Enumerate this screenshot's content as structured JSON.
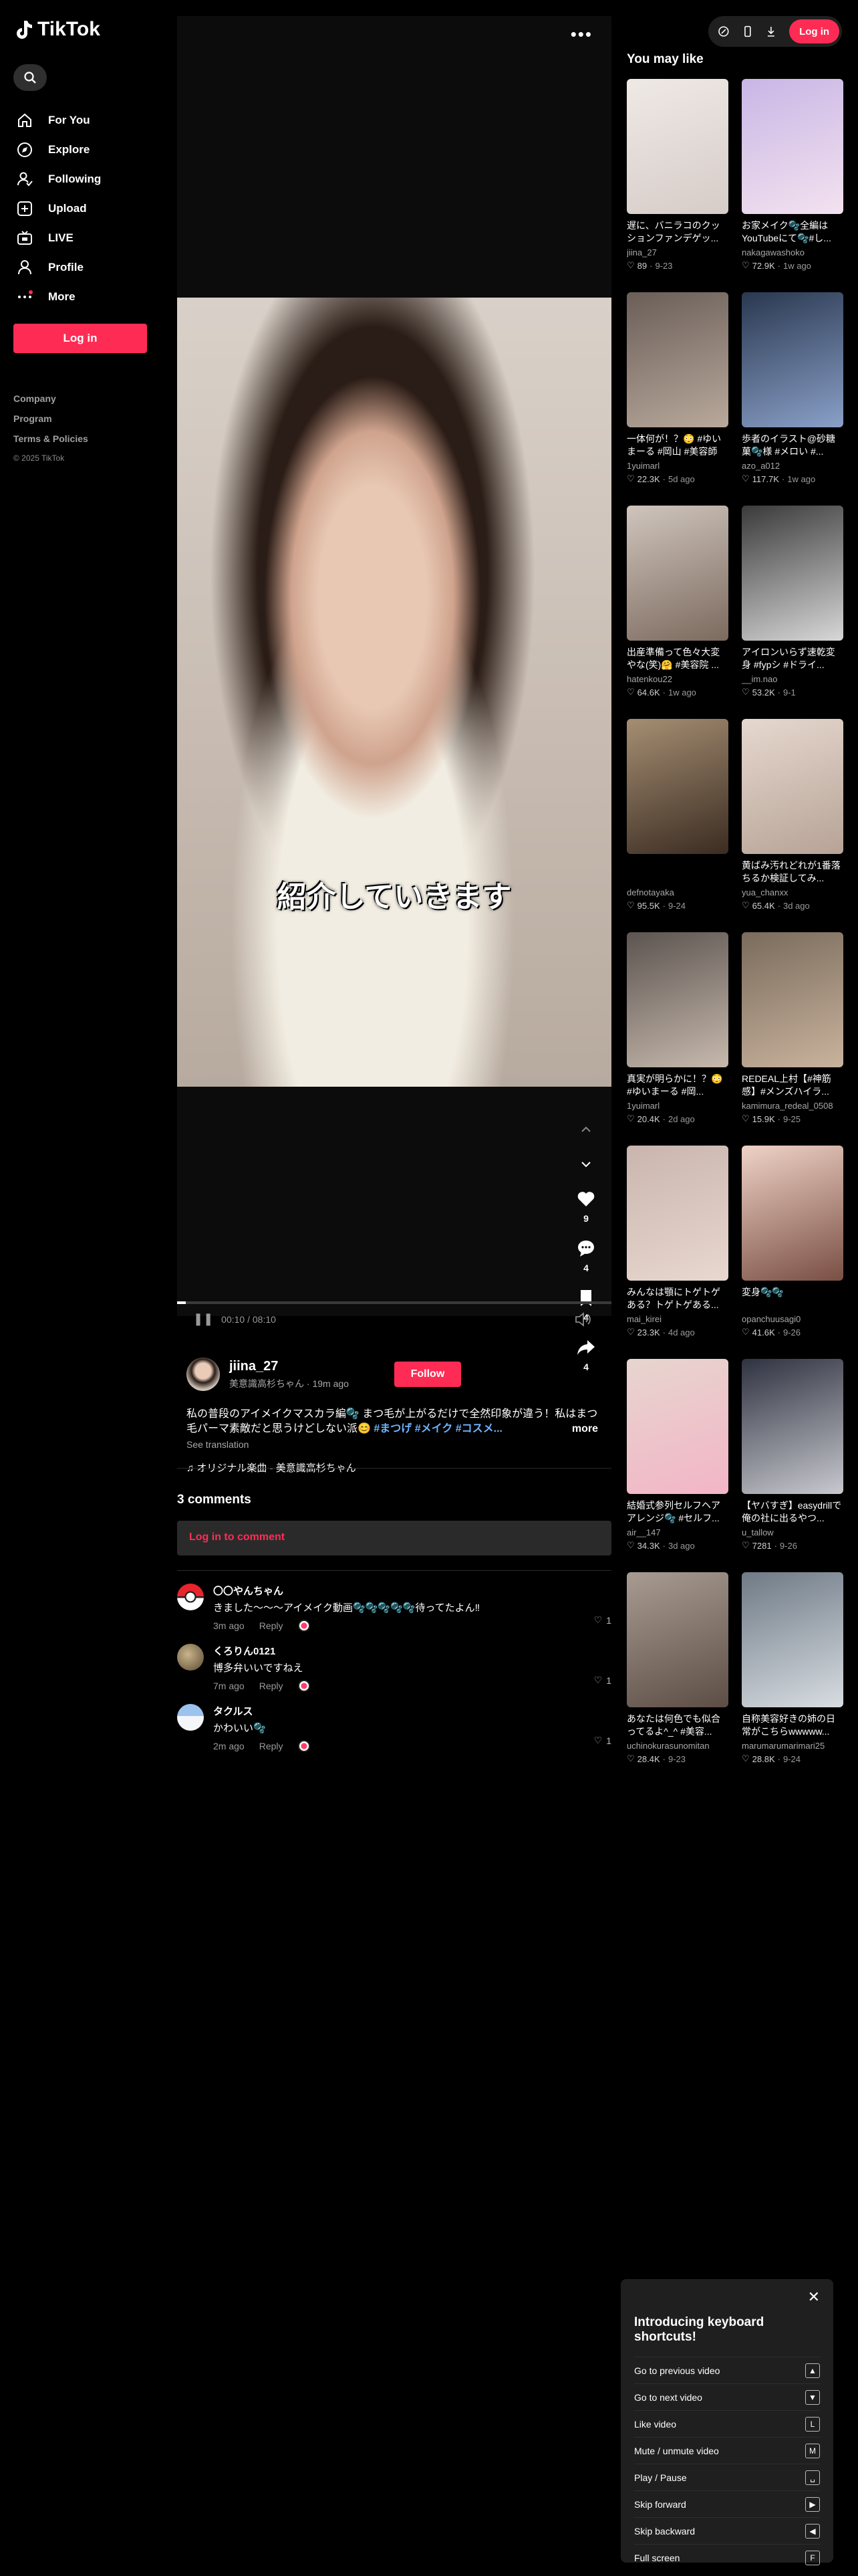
{
  "app": {
    "name": "TikTok"
  },
  "sidebar": {
    "items": [
      {
        "label": "For You",
        "icon": "home-icon"
      },
      {
        "label": "Explore",
        "icon": "compass-icon"
      },
      {
        "label": "Following",
        "icon": "following-icon"
      },
      {
        "label": "Upload",
        "icon": "upload-icon"
      },
      {
        "label": "LIVE",
        "icon": "live-icon"
      },
      {
        "label": "Profile",
        "icon": "profile-icon"
      },
      {
        "label": "More",
        "icon": "more-icon"
      }
    ],
    "login_label": "Log in",
    "footer": [
      "Company",
      "Program",
      "Terms & Policies"
    ],
    "copyright": "© 2025 TikTok"
  },
  "video": {
    "caption_overlay": "紹介していきます",
    "likes": "9",
    "comments": "4",
    "saves": "4",
    "shares": "4",
    "time": "00:10 / 08:10",
    "progress": 0.02
  },
  "author": {
    "username": "jiina_27",
    "display": "美意識高杉ちゃん",
    "posted": "19m ago",
    "follow_label": "Follow"
  },
  "description": {
    "text": "私の普段のアイメイクマスカラ編🫧 まつ毛が上がるだけで全然印象が違う！私はまつ毛パーマ素敵だと思うけどしない派😊",
    "tags": "#まつげ #メイク #コスメ...",
    "more": "more",
    "see_translation": "See translation",
    "music": "♫ オリジナル楽曲 - 美意識高杉ちゃん"
  },
  "comments_section": {
    "title": "3 comments",
    "login_prompt": "Log in to comment",
    "reply_label": "Reply",
    "items": [
      {
        "name": "〇〇やんちゃん",
        "text": "きました〜〜〜アイメイク動画🫧🫧🫧🫧🫧待ってたよん‼︎",
        "time": "3m ago",
        "likes": "1",
        "avatar_color": "#e8242c"
      },
      {
        "name": "くろりん0121",
        "text": "博多弁いいですねえ",
        "time": "7m ago",
        "likes": "1",
        "avatar_color": "#8a7a5c"
      },
      {
        "name": "タクルス",
        "text": "かわいい🫧",
        "time": "2m ago",
        "likes": "1",
        "avatar_color": "#5a86c8"
      }
    ]
  },
  "topbar": {
    "login_label": "Log in"
  },
  "you_may_like": {
    "title": "You may like",
    "cards": [
      {
        "title": "遅に、バニラコのクッションファンデゲッ...",
        "user": "jiina_27",
        "likes": "89",
        "date": "9-23",
        "thumb_text": "",
        "colors": [
          "#efe9e6",
          "#d6ccc8"
        ]
      },
      {
        "title": "お家メイク🫧全編はYouTubeにて🫧#し...",
        "user": "nakagawashoko",
        "likes": "72.9K",
        "date": "1w ago",
        "thumb_text": "",
        "colors": [
          "#c9b6e6",
          "#f3e2ef"
        ]
      },
      {
        "title": "一体何が！？😳 #ゆいまーる #岡山 #美容師",
        "user": "1yuimarl",
        "likes": "22.3K",
        "date": "5d ago",
        "thumb_text": "",
        "colors": [
          "#6a5e58",
          "#b9a99c"
        ]
      },
      {
        "title": "歩者のイラスト@砂糖菓🫧様 #メロい #...",
        "user": "azo_a012",
        "likes": "117.7K",
        "date": "1w ago",
        "thumb_text": "",
        "colors": [
          "#2a3850",
          "#8aa0c8"
        ]
      },
      {
        "title": "出産準備って色々大変やな(笑)🤗 #美容院 ...",
        "user": "hatenkou22",
        "likes": "64.6K",
        "date": "1w ago",
        "thumb_text": "",
        "colors": [
          "#cfc5bd",
          "#7c6a5e"
        ]
      },
      {
        "title": "アイロンいらず速乾変身 #fypシ #ドライ...",
        "user": "__im.nao",
        "likes": "53.2K",
        "date": "9-1",
        "thumb_text": "",
        "colors": [
          "#3a3a3a",
          "#d8d8d8"
        ]
      },
      {
        "title": "",
        "user": "defnotayaka",
        "likes": "95.5K",
        "date": "9-24",
        "thumb_text": "",
        "colors": [
          "#a58e72",
          "#3b2c22"
        ]
      },
      {
        "title": "黄ばみ汚れどれが1番落ちるか検証してみ...",
        "user": "yua_chanxx",
        "likes": "65.4K",
        "date": "3d ago",
        "thumb_text": "",
        "colors": [
          "#e6d8cf",
          "#b7a396"
        ]
      },
      {
        "title": "真実が明らかに！？😳 #ゆいまーる #岡...",
        "user": "1yuimarl",
        "likes": "20.4K",
        "date": "2d ago",
        "thumb_text": "",
        "colors": [
          "#5c5450",
          "#c7b9ad"
        ]
      },
      {
        "title": "REDEAL上村【#神筋感】#メンズハイラ...",
        "user": "kamimura_redeal_0508",
        "likes": "15.9K",
        "date": "9-25",
        "thumb_text": "",
        "colors": [
          "#7a6b5c",
          "#c9b39d"
        ]
      },
      {
        "title": "みんなは顎にトゲトゲある？トゲトゲある...",
        "user": "mai_kirei",
        "likes": "23.3K",
        "date": "4d ago",
        "thumb_text": "",
        "colors": [
          "#c9b5ad",
          "#e9d8d0"
        ]
      },
      {
        "title": "変身🫧🫧",
        "user": "opanchuusagi0",
        "likes": "41.6K",
        "date": "9-26",
        "thumb_text": "",
        "colors": [
          "#efd2c6",
          "#7a4f44"
        ]
      },
      {
        "title": "結婚式参列セルフヘアアレンジ🫧 #セルフ...",
        "user": "air__147",
        "likes": "34.3K",
        "date": "3d ago",
        "thumb_text": "",
        "colors": [
          "#e7d5cf",
          "#f3b5c6"
        ]
      },
      {
        "title": "【ヤバすぎ】easydrillで俺の社に出るやつ...",
        "user": "u_tallow",
        "likes": "7281",
        "date": "9-26",
        "thumb_text": "",
        "colors": [
          "#2f3240",
          "#c8c9cf"
        ]
      },
      {
        "title": "あなたは何色でも似合ってるよ^_^ #美容...",
        "user": "uchinokurasunomitan",
        "likes": "28.4K",
        "date": "9-23",
        "thumb_text": "",
        "colors": [
          "#a89b92",
          "#5c4e45"
        ]
      },
      {
        "title": "自称美容好きの姉の日常がこちらwwwww...",
        "user": "marumarumarimari25",
        "likes": "28.8K",
        "date": "9-24",
        "thumb_text": "",
        "colors": [
          "#6f7a86",
          "#d8dde2"
        ]
      }
    ]
  },
  "shortcuts": {
    "title": "Introducing keyboard shortcuts!",
    "items": [
      {
        "label": "Go to previous video",
        "key": "▲"
      },
      {
        "label": "Go to next video",
        "key": "▼"
      },
      {
        "label": "Like video",
        "key": "L"
      },
      {
        "label": "Mute / unmute video",
        "key": "M"
      },
      {
        "label": "Play / Pause",
        "key": "␣"
      },
      {
        "label": "Skip forward",
        "key": "▶"
      },
      {
        "label": "Skip backward",
        "key": "◀"
      },
      {
        "label": "Full screen",
        "key": "F"
      }
    ]
  },
  "colors": {
    "accent": "#fe2c55",
    "background": "#000000",
    "panel": "#1f1f1f"
  }
}
